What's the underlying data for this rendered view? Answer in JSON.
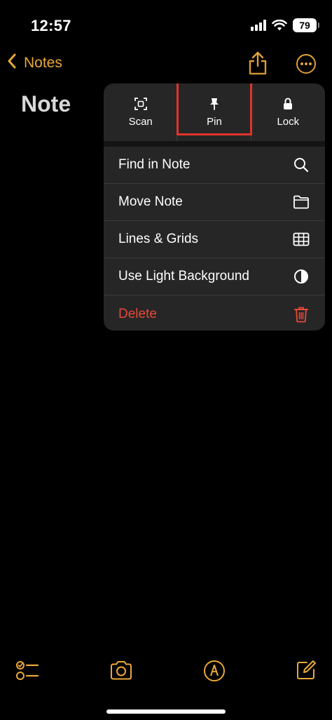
{
  "status_bar": {
    "time": "12:57",
    "battery": "79"
  },
  "nav": {
    "back_label": "Notes"
  },
  "note": {
    "title": "Note"
  },
  "menu": {
    "quick_actions": [
      {
        "label": "Scan",
        "icon": "scan-icon"
      },
      {
        "label": "Pin",
        "icon": "pin-icon"
      },
      {
        "label": "Lock",
        "icon": "lock-icon"
      }
    ],
    "items": [
      {
        "label": "Find in Note",
        "icon": "search-icon"
      },
      {
        "label": "Move Note",
        "icon": "folder-icon"
      },
      {
        "label": "Lines & Grids",
        "icon": "grid-icon"
      },
      {
        "label": "Use Light Background",
        "icon": "contrast-icon"
      },
      {
        "label": "Delete",
        "icon": "trash-icon"
      }
    ]
  },
  "toolbar": {
    "items": [
      "checklist-icon",
      "camera-icon",
      "markup-icon",
      "compose-icon"
    ]
  },
  "colors": {
    "accent": "#e9a83a",
    "danger": "#e8483a",
    "highlight": "#e0342a",
    "menu_bg": "#262626",
    "background": "#000000"
  }
}
